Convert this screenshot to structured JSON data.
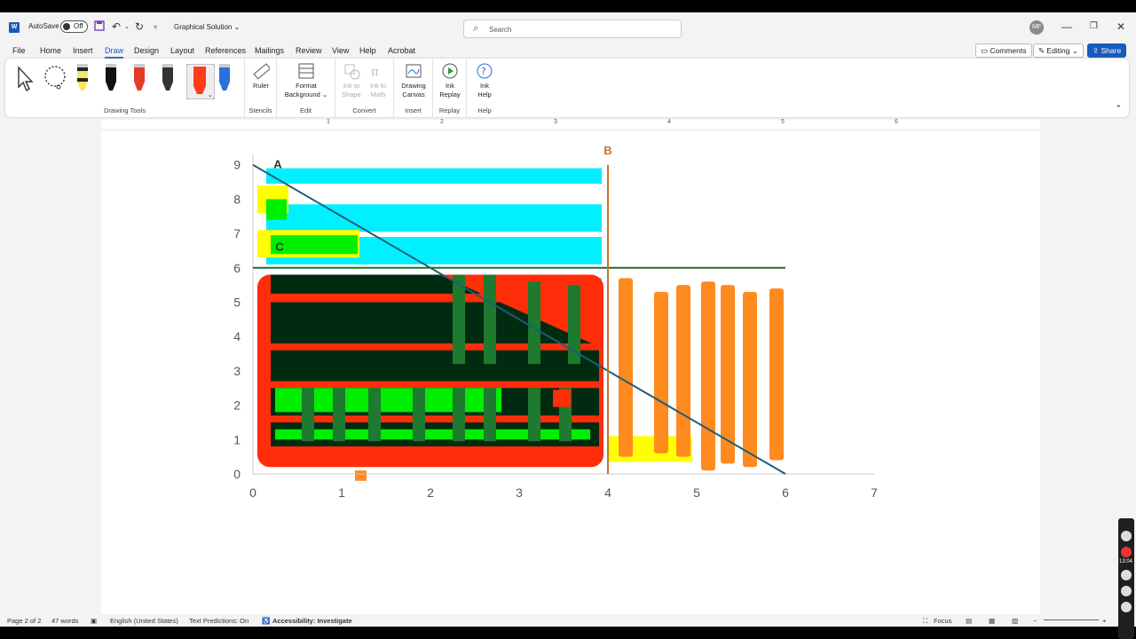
{
  "titlebar": {
    "autosave_label": "AutoSave",
    "autosave_state": "Off",
    "doc_title": "Graphical Solution",
    "search_placeholder": "Search",
    "avatar_initials": "MF"
  },
  "menus": [
    "File",
    "Home",
    "Insert",
    "Draw",
    "Design",
    "Layout",
    "References",
    "Mailings",
    "Review",
    "View",
    "Help",
    "Acrobat"
  ],
  "active_menu": "Draw",
  "right_buttons": {
    "comments": "Comments",
    "editing": "Editing",
    "share": "Share"
  },
  "ribbon": {
    "groups": {
      "drawing_tools": "Drawing Tools",
      "stencils": "Stencils",
      "edit": "Edit",
      "convert": "Convert",
      "insert": "Insert",
      "replay": "Replay",
      "help": "Help"
    },
    "buttons": {
      "ruler": "Ruler",
      "format_bg_1": "Format",
      "format_bg_2": "Background",
      "ink_shape_1": "Ink to",
      "ink_shape_2": "Shape",
      "ink_math_1": "Ink to",
      "ink_math_2": "Math",
      "canvas_1": "Drawing",
      "canvas_2": "Canvas",
      "replay_1": "Ink",
      "replay_2": "Replay",
      "help_1": "Ink",
      "help_2": "Help"
    },
    "pens": [
      {
        "name": "select-tool-icon",
        "color": "#333333"
      },
      {
        "name": "lasso-tool-icon",
        "color": "#333333"
      },
      {
        "name": "highlighter-yellow-pen-icon",
        "color": "#f5e663"
      },
      {
        "name": "black-pen-icon",
        "color": "#111111"
      },
      {
        "name": "red-pen-icon",
        "color": "#e53a2a"
      },
      {
        "name": "pencil-icon",
        "color": "#333333"
      },
      {
        "name": "red-highlighter-pen-icon",
        "color": "#ff3b1a"
      },
      {
        "name": "blue-pen-icon",
        "color": "#2a6fdb"
      }
    ]
  },
  "ruler_numbers": [
    "1",
    "2",
    "3",
    "4",
    "5",
    "6"
  ],
  "chart_data": {
    "type": "line",
    "x_ticks": [
      "0",
      "1",
      "2",
      "3",
      "4",
      "5",
      "6",
      "7"
    ],
    "y_ticks": [
      "0",
      "1",
      "2",
      "3",
      "4",
      "5",
      "6",
      "7",
      "8",
      "9"
    ],
    "xlim": [
      0,
      7
    ],
    "ylim": [
      0,
      9
    ],
    "lines": [
      {
        "from": [
          0,
          9
        ],
        "to": [
          6,
          0
        ],
        "color": "#1d5f7a"
      },
      {
        "from": [
          0,
          6
        ],
        "to": [
          6,
          6
        ],
        "color": "#1e6b33"
      },
      {
        "from": [
          4,
          9
        ],
        "to": [
          4,
          0
        ],
        "color": "#c8742c"
      }
    ],
    "labels": [
      {
        "text": "A",
        "x": 0.28,
        "y": 9.0
      },
      {
        "text": "C",
        "x": 0.3,
        "y": 6.6
      },
      {
        "text": "B",
        "x": 4,
        "y": 9.4
      }
    ],
    "colors": {
      "cyan": "#00f0ff",
      "yellow": "#ffff00",
      "green": "#00ee00",
      "dark": "#002b10",
      "red": "#ff2d0a",
      "orange": "#ff8a1e",
      "darkgreen": "#1e7a2e"
    }
  },
  "status": {
    "page": "Page 2 of 2",
    "words": "47 words",
    "language": "English (United States)",
    "predictions": "Text Predictions: On",
    "accessibility": "Accessibility: Investigate",
    "focus": "Focus",
    "side_time": "13:04"
  }
}
